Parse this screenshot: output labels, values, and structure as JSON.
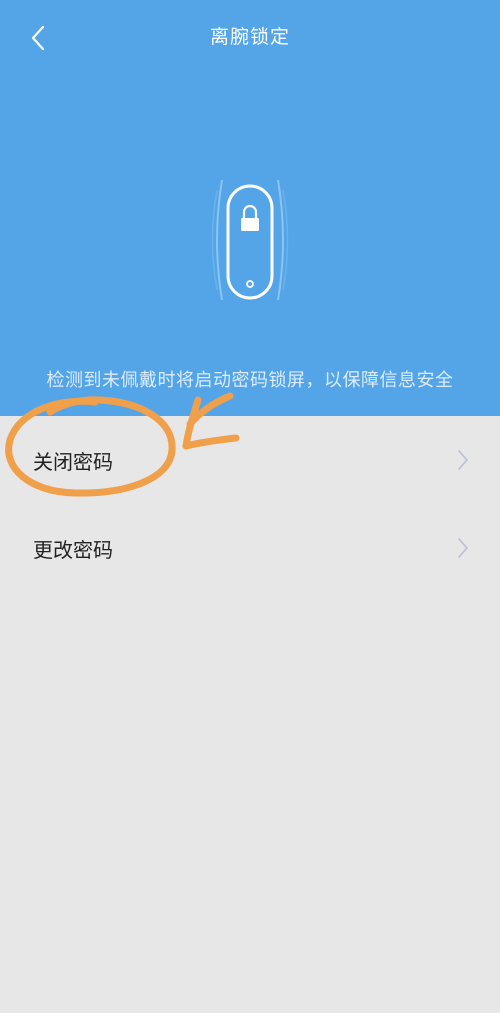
{
  "header": {
    "title": "离腕锁定",
    "description": "检测到未佩戴时将启动密码锁屏，以保障信息安全",
    "background_color": "#54a5e8"
  },
  "icons": {
    "back": "chevron-left-icon",
    "band": "band-lock-icon",
    "chevron": "chevron-right-icon"
  },
  "settings": {
    "items": [
      {
        "label": "关闭密码"
      },
      {
        "label": "更改密码"
      }
    ]
  },
  "annotation_color": "#f0a04b"
}
